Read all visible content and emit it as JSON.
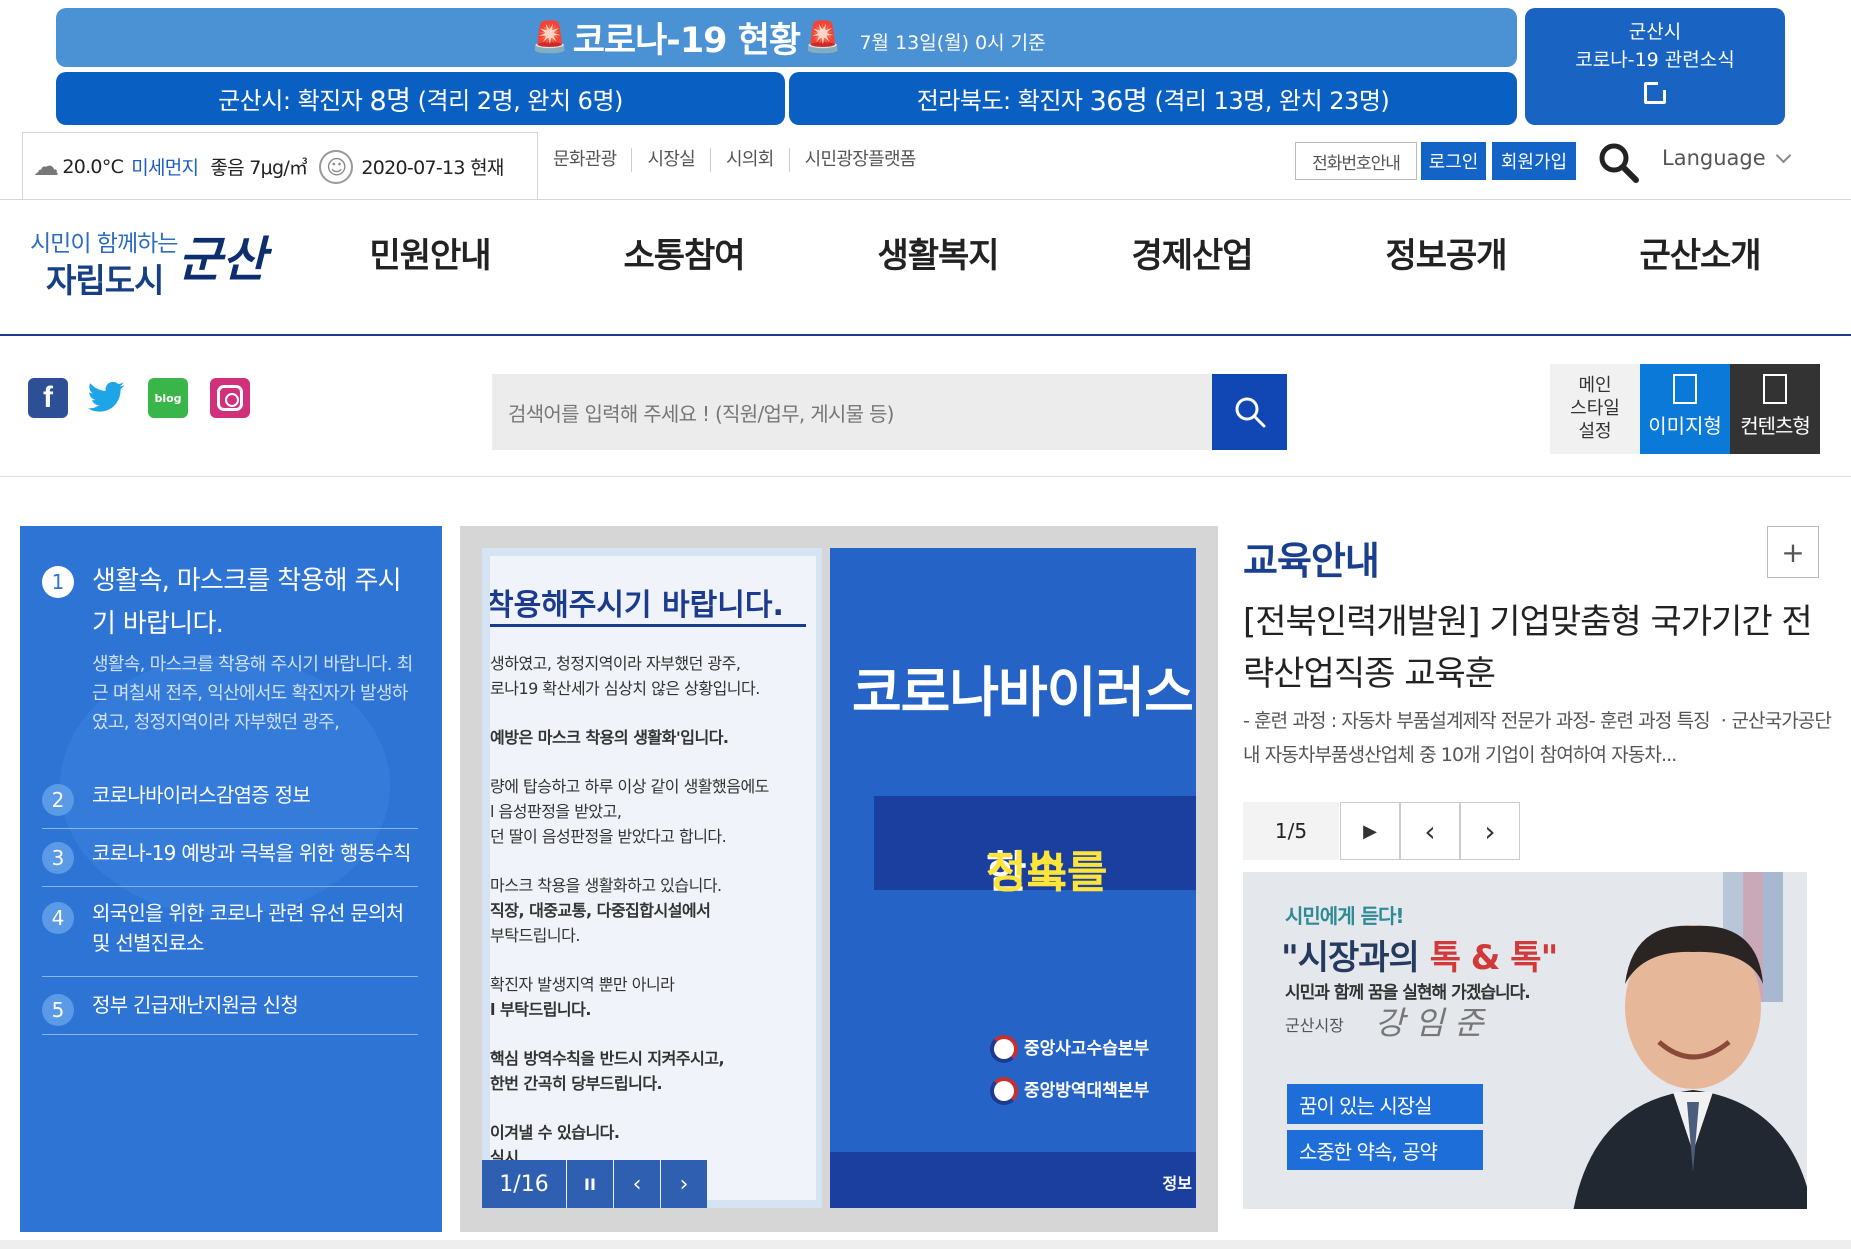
{
  "covid": {
    "title": "코로나-19 현황",
    "date": "7월 13일(월) 0시 기준",
    "city_label": "군산시: 확진자",
    "city_count": "8명",
    "city_detail": "(격리 2명, 완치 6명)",
    "prov_label": "전라북도: 확진자",
    "prov_count": "36명",
    "prov_detail": "(격리 13명, 완치 23명)",
    "news_line1": "군산시",
    "news_line2": "코로나-19 관련소식"
  },
  "utility": {
    "temperature": "20.0°C",
    "dust_label": "미세먼지",
    "dust_value": "좋음 7μg/㎥",
    "date_now": "2020-07-13 현재",
    "links": [
      "문화관광",
      "시장실",
      "시의회",
      "시민광장플랫폼"
    ],
    "phone_button": "전화번호안내",
    "login_button": "로그인",
    "join_button": "회원가입",
    "language": "Language"
  },
  "logo": {
    "line1": "시민이 함께하는",
    "line2": "자립도시",
    "line3": "군산"
  },
  "gnb": [
    "민원안내",
    "소통참여",
    "생활복지",
    "경제산업",
    "정보공개",
    "군산소개"
  ],
  "sns": {
    "blog": "blog"
  },
  "search": {
    "placeholder": "검색어를 입력해 주세요 ! (직원/업무, 게시물 등)"
  },
  "style_setting": {
    "label": "메인\n스타일\n설정",
    "image_type": "이미지형",
    "content_type": "컨텐츠형"
  },
  "notice": {
    "items": [
      {
        "num": "1",
        "title": "생활속, 마스크를 착용해 주시기 바랍니다.",
        "desc": "생활속, 마스크를 착용해 주시기 바랍니다. 최근 며칠새 전주, 익산에서도 확진자가 발생하였고, 청정지역이라 자부했던 광주,"
      },
      {
        "num": "2",
        "title": "코로나바이러스감염증 정보"
      },
      {
        "num": "3",
        "title": "코로나-19 예방과 극복을 위한 행동수칙"
      },
      {
        "num": "4",
        "title": "외국인을 위한 코로나 관련 유선 문의처 및 선별진료소"
      },
      {
        "num": "5",
        "title": "정부 긴급재난지원금 신청"
      }
    ]
  },
  "slide": {
    "paper_title": "착용해주시기 바랍니다.",
    "paper_lines": [
      "생하였고, 청정지역이라 자부했던 광주,",
      "로나19 확산세가 심상치 않은 상황입니다.",
      "",
      "예방은 마스크 착용의 생활화'입니다.",
      "",
      "량에 탑승하고 하루 이상 같이 생활했음에도",
      "l 음성판정을 받았고,",
      "던 딸이 음성판정을 받았다고 합니다.",
      "",
      "마스크 착용을 생활화하고 있습니다.",
      "직장, 대중교통, 다중집합시설에서",
      "부탁드립니다.",
      "",
      "확진자 발생지역 뿐만 아니라",
      "l 부탁드립니다.",
      "",
      "핵심 방역수칙을 반드시 지켜주시고,",
      "한번 간곡히 당부드립니다.",
      "",
      "이겨낼 수 있습니다.",
      "실시"
    ],
    "blue_title": "코로나바이러스",
    "band_yellow": "신속",
    "band_white": "한",
    "band_yellow2": "정보를",
    "org1": "중앙사고수습본부",
    "org2": "중앙방역대책본부",
    "bottom_label": "정보",
    "counter": "1/16",
    "pause": "II",
    "prev": "‹",
    "next": "›"
  },
  "education": {
    "section_title": "교육안내",
    "plus": "+",
    "headline": "[전북인력개발원] 기업맞춤형 국가기간 전략산업직종 교육훈",
    "desc": "- 훈련 과정 : 자동차 부품설계제작 전문가 과정- 훈련 과정 특징 ㆍ군산국가공단내 자동차부품생산업체 중 10개 기업이 참여하여 자동차...",
    "counter": "1/5",
    "play": "▶",
    "prev": "‹",
    "next": "›"
  },
  "mayor_banner": {
    "line1": "시민에게 듣다!",
    "line2_a": "\"시장과의",
    "line2_b": "톡 & 톡\"",
    "line3": "시민과 함께 꿈을 실현해 가겠습니다.",
    "line4": "군산시장",
    "signature": "강 임 준",
    "btn1": "꿈이 있는 시장실",
    "btn2": "소중한 약속, 공약"
  }
}
